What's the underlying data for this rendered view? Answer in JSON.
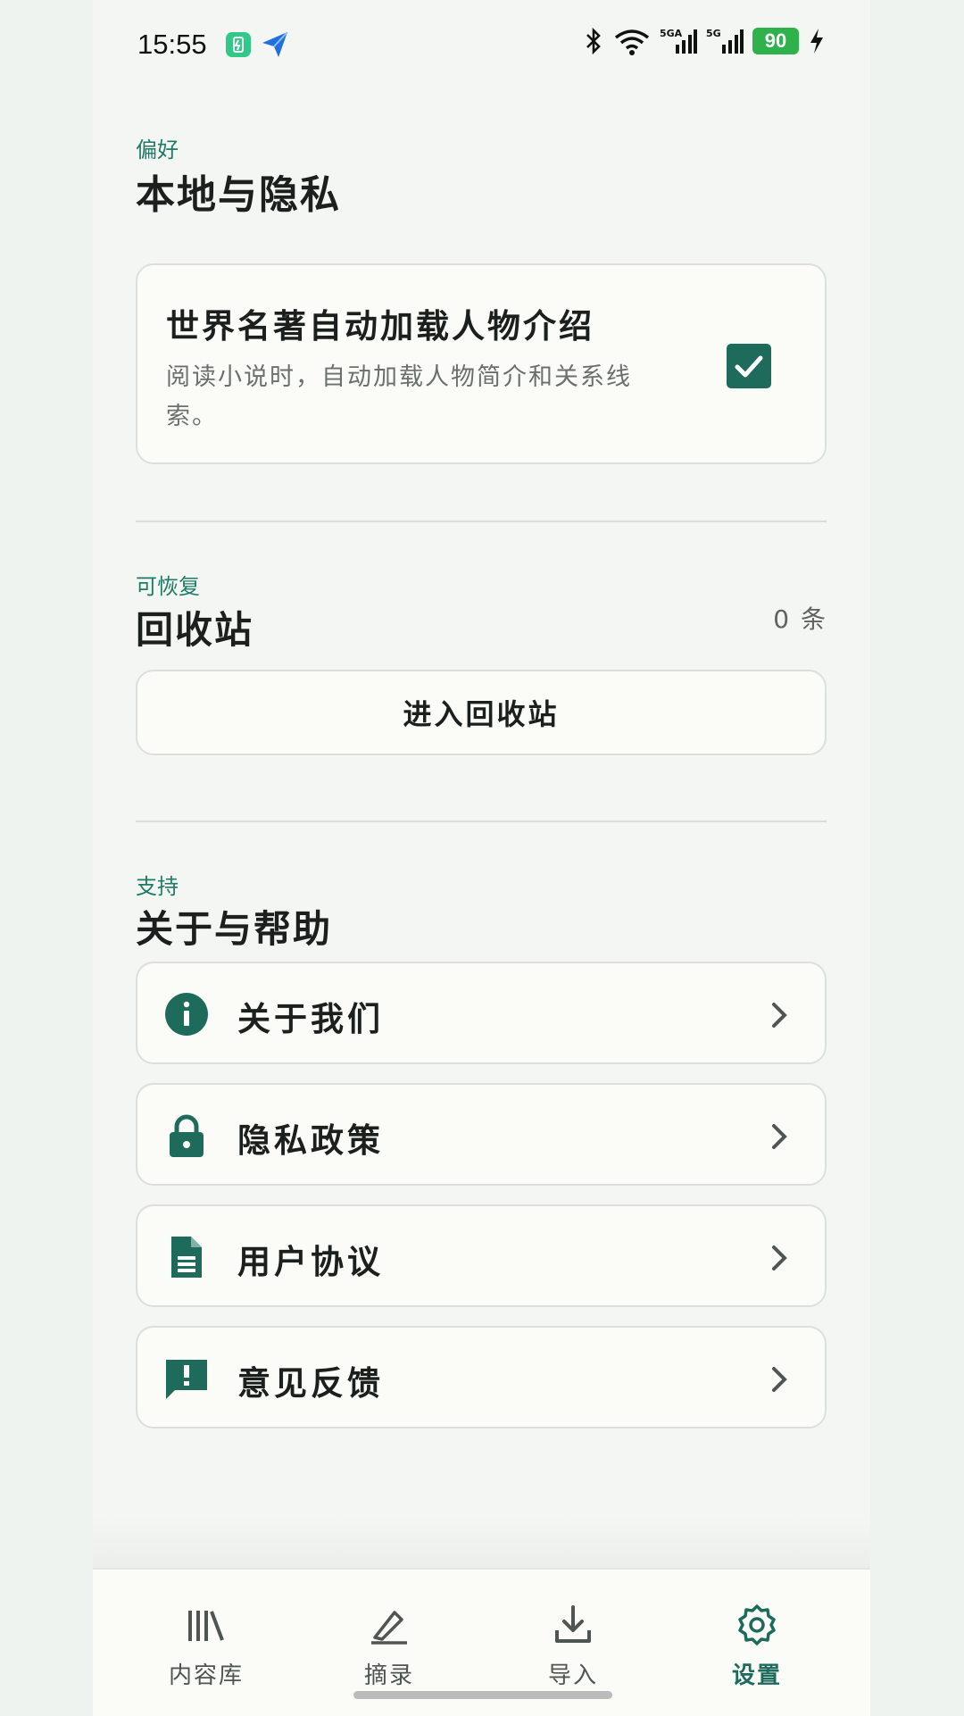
{
  "status_bar": {
    "time": "15:55",
    "battery": "90"
  },
  "preferences": {
    "eyebrow": "偏好",
    "title": "本地与隐私",
    "auto_load": {
      "title": "世界名著自动加载人物介绍",
      "description": "阅读小说时，自动加载人物简介和关系线索。",
      "checked": true
    }
  },
  "recycle": {
    "eyebrow": "可恢复",
    "title": "回收站",
    "count": "0 条",
    "enter_label": "进入回收站"
  },
  "support": {
    "eyebrow": "支持",
    "title": "关于与帮助",
    "items": [
      {
        "label": "关于我们",
        "icon": "info-icon"
      },
      {
        "label": "隐私政策",
        "icon": "lock-icon"
      },
      {
        "label": "用户协议",
        "icon": "document-icon"
      },
      {
        "label": "意见反馈",
        "icon": "feedback-icon"
      }
    ]
  },
  "nav": {
    "items": [
      {
        "label": "内容库",
        "icon": "library-icon"
      },
      {
        "label": "摘录",
        "icon": "highlight-pen-icon"
      },
      {
        "label": "导入",
        "icon": "download-icon"
      },
      {
        "label": "设置",
        "icon": "gear-icon"
      }
    ],
    "active": "设置"
  },
  "colors": {
    "accent": "#1e6b5c",
    "background": "#f3f6f3",
    "card": "#fbfcf8"
  }
}
